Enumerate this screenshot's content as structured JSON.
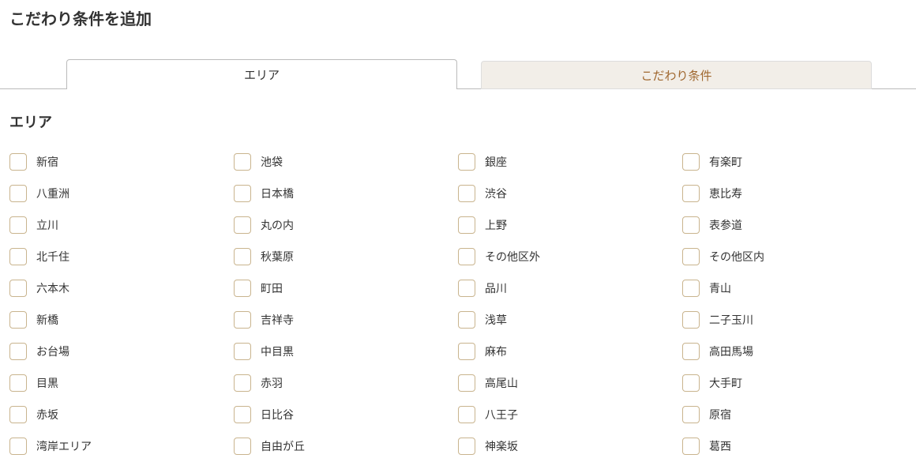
{
  "page_title": "こだわり条件を追加",
  "tabs": {
    "active": "エリア",
    "inactive": "こだわり条件"
  },
  "section_heading": "エリア",
  "areas": [
    "新宿",
    "池袋",
    "銀座",
    "有楽町",
    "八重洲",
    "日本橋",
    "渋谷",
    "恵比寿",
    "立川",
    "丸の内",
    "上野",
    "表参道",
    "北千住",
    "秋葉原",
    "その他区外",
    "その他区内",
    "六本木",
    "町田",
    "品川",
    "青山",
    "新橋",
    "吉祥寺",
    "浅草",
    "二子玉川",
    "お台場",
    "中目黒",
    "麻布",
    "高田馬場",
    "目黒",
    "赤羽",
    "高尾山",
    "大手町",
    "赤坂",
    "日比谷",
    "八王子",
    "原宿",
    "湾岸エリア",
    "自由が丘",
    "神楽坂",
    "葛西"
  ]
}
